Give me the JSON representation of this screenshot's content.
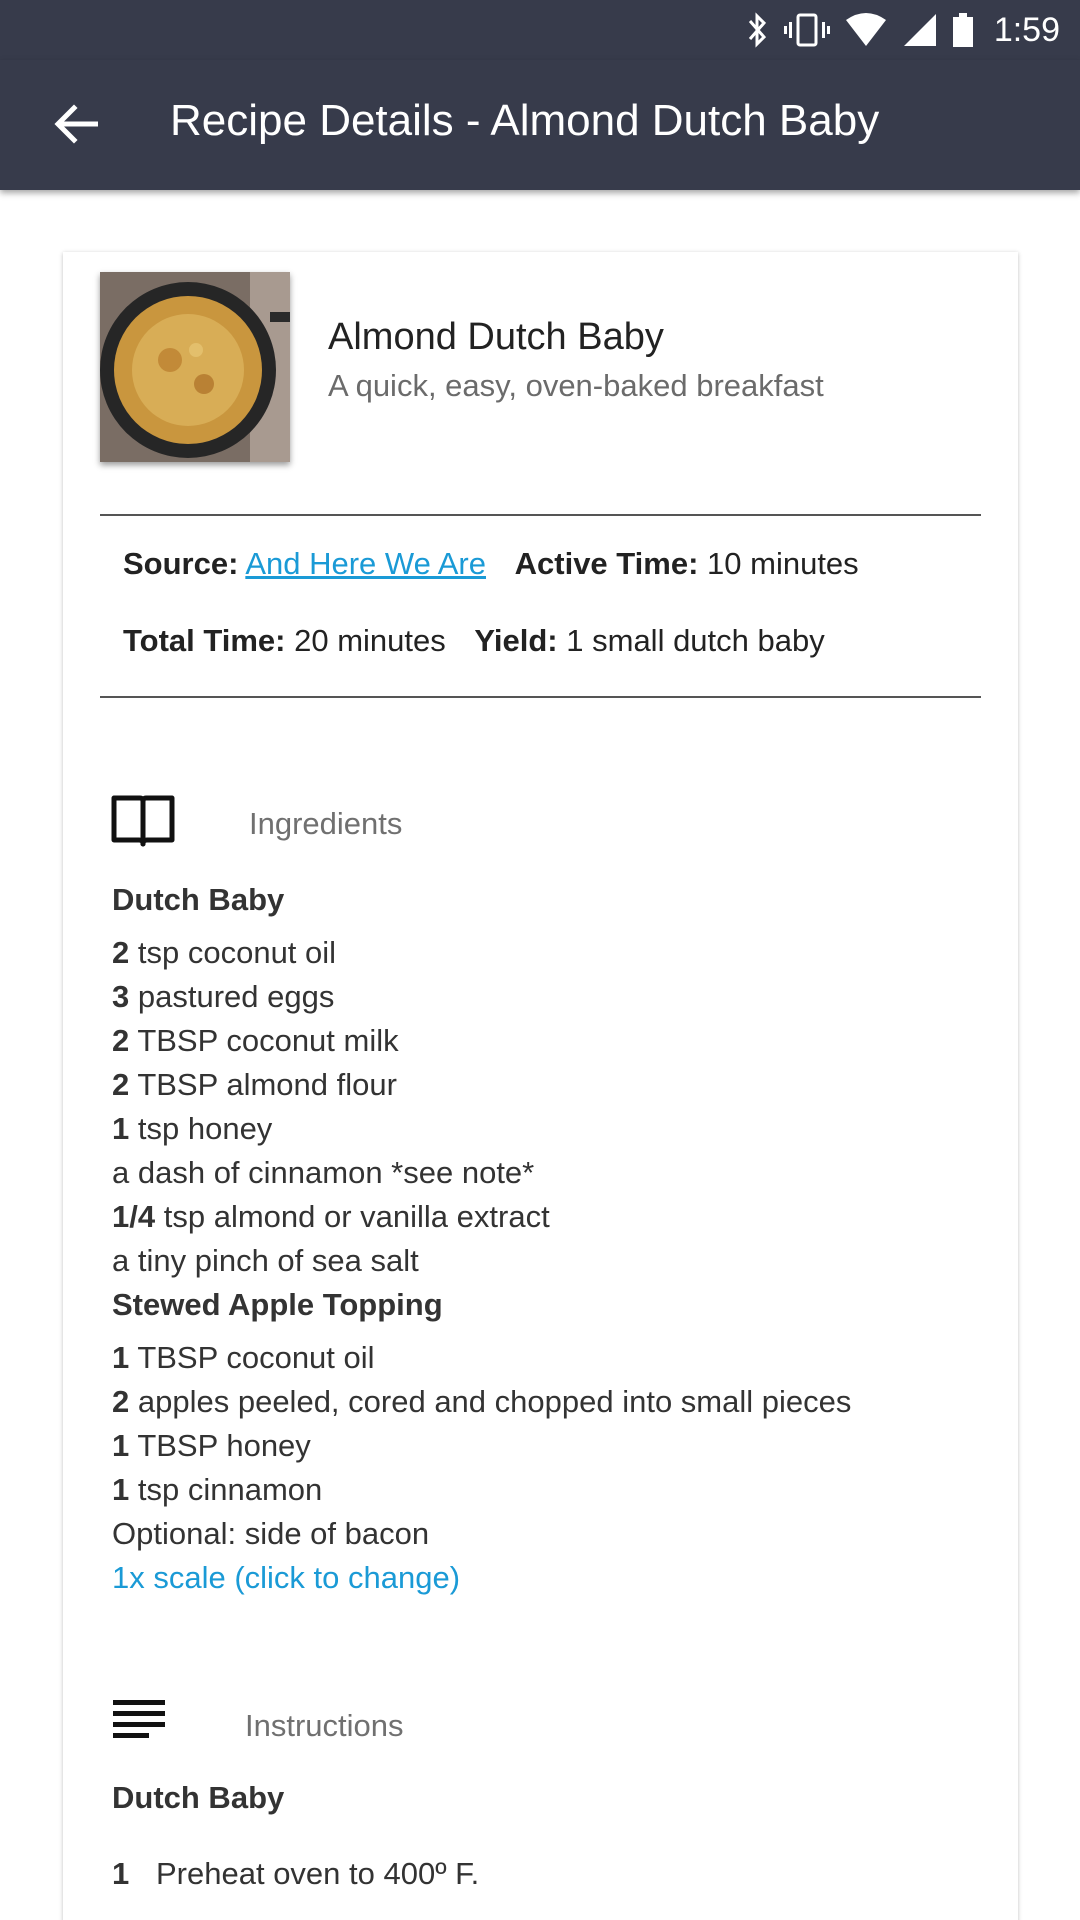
{
  "status_bar": {
    "time": "1:59",
    "icons": [
      "bluetooth-icon",
      "vibrate-icon",
      "wifi-icon",
      "signal-icon",
      "battery-icon"
    ]
  },
  "app_bar": {
    "title": "Recipe Details - Almond Dutch Baby",
    "back_icon": "arrow-back-icon"
  },
  "recipe": {
    "name": "Almond Dutch Baby",
    "description": "A quick, easy, oven-baked breakfast",
    "source_label": "Source:",
    "source_value": "And Here We Are",
    "active_time_label": "Active Time:",
    "active_time_value": "10 minutes",
    "total_time_label": "Total Time:",
    "total_time_value": "20 minutes",
    "yield_label": "Yield:",
    "yield_value": "1 small dutch baby"
  },
  "ingredients": {
    "heading": "Ingredients",
    "icon": "book-open-icon",
    "groups": [
      {
        "title": "Dutch Baby",
        "items": [
          {
            "amount": "2",
            "text": "tsp coconut oil"
          },
          {
            "amount": "3",
            "text": "pastured eggs"
          },
          {
            "amount": "2",
            "text": "TBSP coconut milk"
          },
          {
            "amount": "2",
            "text": "TBSP almond flour"
          },
          {
            "amount": "1",
            "text": "tsp honey"
          },
          {
            "amount": "",
            "text": "a dash of cinnamon *see note*"
          },
          {
            "amount": "1/4",
            "text": "tsp almond or vanilla extract"
          },
          {
            "amount": "",
            "text": "a tiny pinch of sea salt"
          }
        ]
      },
      {
        "title": "Stewed Apple Topping",
        "items": [
          {
            "amount": "1",
            "text": "TBSP coconut oil"
          },
          {
            "amount": "2",
            "text": "apples peeled, cored and chopped into small pieces"
          },
          {
            "amount": "1",
            "text": "TBSP honey"
          },
          {
            "amount": "1",
            "text": "tsp cinnamon"
          },
          {
            "amount": "",
            "text": "Optional: side of bacon"
          }
        ]
      }
    ],
    "scale_link": "1x scale (click to change)"
  },
  "instructions": {
    "heading": "Instructions",
    "icon": "text-lines-icon",
    "groups": [
      {
        "title": "Dutch Baby",
        "steps": [
          {
            "number": "1",
            "text": "Preheat oven to 400º F."
          }
        ]
      }
    ]
  }
}
